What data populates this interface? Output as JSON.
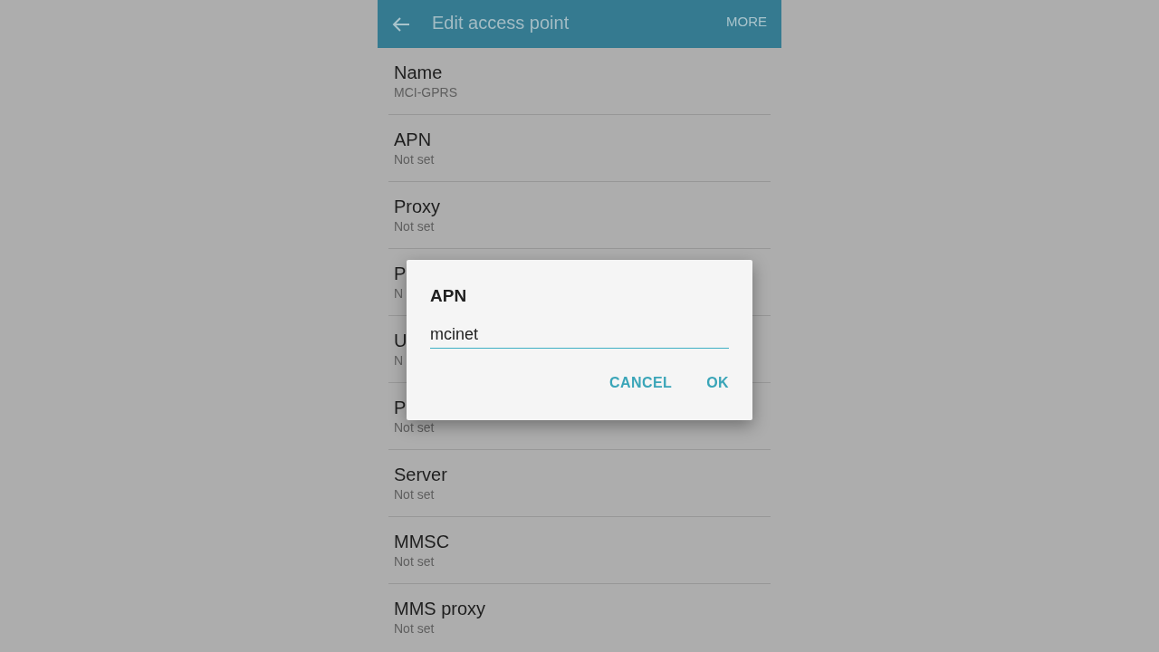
{
  "toolbar": {
    "title": "Edit access point",
    "action": "MORE"
  },
  "settings": [
    {
      "title": "Name",
      "value": "MCI-GPRS"
    },
    {
      "title": "APN",
      "value": "Not set"
    },
    {
      "title": "Proxy",
      "value": "Not set"
    },
    {
      "title": "P",
      "value": "N"
    },
    {
      "title": "U",
      "value": "N"
    },
    {
      "title": "P",
      "value": "Not set"
    },
    {
      "title": "Server",
      "value": "Not set"
    },
    {
      "title": "MMSC",
      "value": "Not set"
    },
    {
      "title": "MMS proxy",
      "value": "Not set"
    }
  ],
  "dialog": {
    "title": "APN",
    "input_value": "mcinet",
    "buttons": [
      "CANCEL",
      "OK"
    ]
  }
}
